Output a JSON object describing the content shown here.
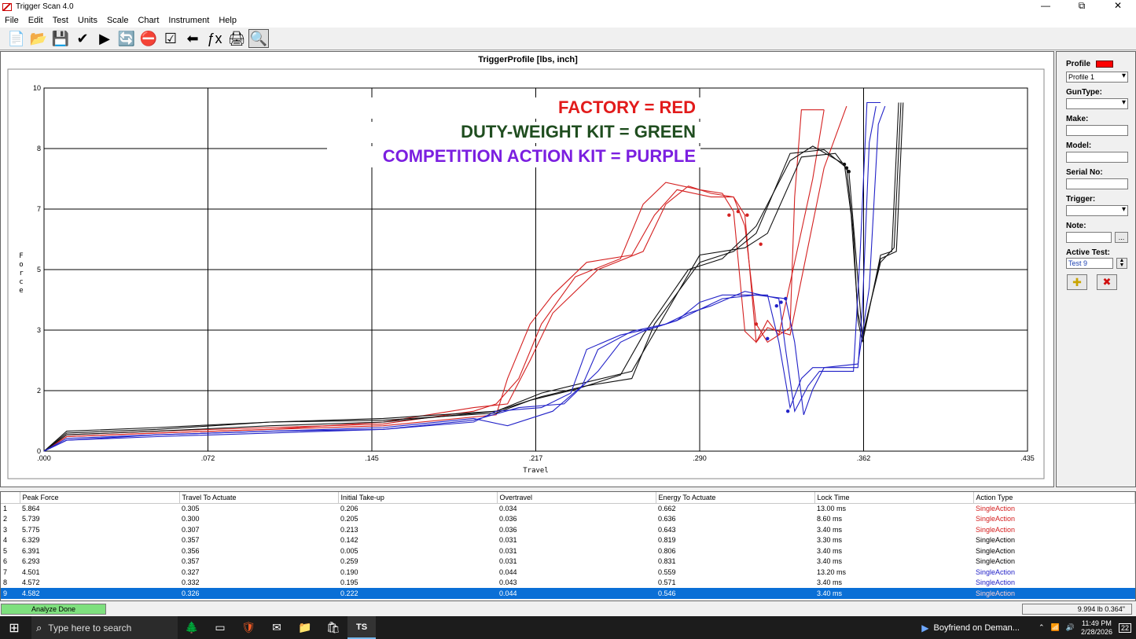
{
  "window": {
    "title": "Trigger Scan 4.0",
    "min": "—",
    "restore": "⧉",
    "close": "✕"
  },
  "menu": [
    "File",
    "Edit",
    "Test",
    "Units",
    "Scale",
    "Chart",
    "Instrument",
    "Help"
  ],
  "toolbar": [
    {
      "name": "new-icon",
      "glyph": "📄"
    },
    {
      "name": "open-folder-icon",
      "glyph": "📂"
    },
    {
      "name": "save-icon",
      "glyph": "💾"
    },
    {
      "name": "checkmark-icon",
      "glyph": "✔"
    },
    {
      "name": "play-icon",
      "glyph": "▶"
    },
    {
      "name": "refresh-icon",
      "glyph": "🔄"
    },
    {
      "name": "stop-icon",
      "glyph": "⛔"
    },
    {
      "name": "checklist-icon",
      "glyph": "☑"
    },
    {
      "name": "back-arrow-icon",
      "glyph": "⬅"
    },
    {
      "name": "function-icon",
      "glyph": "ƒx"
    },
    {
      "name": "print-icon",
      "glyph": "🖨"
    },
    {
      "name": "print-preview-icon",
      "glyph": "🔍"
    }
  ],
  "chart_data": {
    "type": "line",
    "title": "TriggerProfile [lbs, inch]",
    "xlabel": "Travel",
    "ylabel": "Force",
    "x_ticks": [
      ".000",
      ".072",
      ".145",
      ".217",
      ".290",
      ".362",
      ".435"
    ],
    "y_ticks": [
      "0",
      "2",
      "3",
      "5",
      "7",
      "8",
      "10"
    ],
    "xlim": [
      0,
      0.435
    ],
    "ylim": [
      0,
      10
    ],
    "grid": true,
    "annotations": [
      {
        "text": "FACTORY = RED",
        "color": "#e21b1b"
      },
      {
        "text": "DUTY-WEIGHT KIT = GREEN",
        "color": "#1f4d1f"
      },
      {
        "text": "COMPETITION ACTION KIT = PURPLE",
        "color": "#7b1fe0"
      }
    ],
    "series": [
      {
        "color": "#d42020",
        "x": [
          0,
          0.01,
          0.05,
          0.1,
          0.15,
          0.2,
          0.205,
          0.215,
          0.225,
          0.24,
          0.26,
          0.27,
          0.28,
          0.295,
          0.305,
          0.31,
          0.315,
          0.32,
          0.325,
          0.33,
          0.332,
          0.335,
          0.345
        ],
        "y": [
          0,
          0.4,
          0.5,
          0.6,
          0.7,
          1.0,
          2.0,
          3.5,
          4.3,
          5.2,
          5.4,
          6.5,
          7.2,
          7.0,
          7.0,
          6.2,
          3.5,
          3.0,
          3.2,
          3.4,
          7.0,
          9.4,
          9.4
        ],
        "dots": [
          [
            0.307,
            6.6
          ],
          [
            0.315,
            3.5
          ]
        ]
      },
      {
        "color": "#d42020",
        "x": [
          0,
          0.01,
          0.05,
          0.1,
          0.15,
          0.19,
          0.2,
          0.21,
          0.22,
          0.235,
          0.255,
          0.265,
          0.275,
          0.29,
          0.3,
          0.305,
          0.31,
          0.315,
          0.32,
          0.325,
          0.34,
          0.345
        ],
        "y": [
          0,
          0.45,
          0.55,
          0.65,
          0.75,
          1.1,
          1.3,
          2.0,
          3.5,
          4.8,
          5.3,
          6.8,
          7.4,
          7.2,
          7.1,
          6.6,
          3.3,
          3.0,
          3.6,
          3.2,
          7.5,
          9.4
        ],
        "dots": [
          [
            0.303,
            6.5
          ],
          [
            0.317,
            5.7
          ]
        ]
      },
      {
        "color": "#d42020",
        "x": [
          0,
          0.01,
          0.05,
          0.1,
          0.15,
          0.19,
          0.205,
          0.215,
          0.225,
          0.245,
          0.265,
          0.275,
          0.285,
          0.295,
          0.305,
          0.31,
          0.315,
          0.32,
          0.33,
          0.345,
          0.355
        ],
        "y": [
          0,
          0.4,
          0.5,
          0.6,
          0.8,
          1.2,
          1.3,
          2.5,
          3.8,
          5.0,
          5.5,
          6.8,
          7.3,
          7.1,
          7.0,
          6.5,
          3.0,
          3.4,
          3.2,
          7.8,
          9.5
        ],
        "dots": [
          [
            0.311,
            6.5
          ]
        ]
      },
      {
        "color": "#111111",
        "x": [
          0,
          0.01,
          0.05,
          0.1,
          0.15,
          0.2,
          0.22,
          0.24,
          0.26,
          0.27,
          0.29,
          0.305,
          0.315,
          0.33,
          0.345,
          0.355,
          0.358,
          0.36,
          0.362,
          0.37,
          0.375,
          0.378
        ],
        "y": [
          0,
          0.5,
          0.6,
          0.8,
          0.9,
          1.1,
          1.5,
          1.8,
          2.0,
          3.5,
          5.2,
          5.5,
          6.0,
          8.2,
          8.3,
          7.8,
          6.0,
          3.6,
          3.0,
          5.4,
          5.5,
          9.6
        ],
        "dots": [
          [
            0.355,
            7.8
          ]
        ]
      },
      {
        "color": "#111111",
        "x": [
          0,
          0.01,
          0.05,
          0.1,
          0.15,
          0.2,
          0.215,
          0.235,
          0.255,
          0.265,
          0.285,
          0.3,
          0.315,
          0.33,
          0.34,
          0.354,
          0.357,
          0.36,
          0.362,
          0.37,
          0.376,
          0.379
        ],
        "y": [
          0,
          0.55,
          0.65,
          0.8,
          0.85,
          1.05,
          1.4,
          1.7,
          2.1,
          3.2,
          5.0,
          5.3,
          6.2,
          8.0,
          8.4,
          7.9,
          6.5,
          3.8,
          3.2,
          5.2,
          5.6,
          9.6
        ],
        "dots": [
          [
            0.354,
            7.9
          ]
        ]
      },
      {
        "color": "#111111",
        "x": [
          0,
          0.01,
          0.05,
          0.1,
          0.15,
          0.2,
          0.22,
          0.24,
          0.26,
          0.275,
          0.29,
          0.31,
          0.32,
          0.335,
          0.35,
          0.356,
          0.359,
          0.362,
          0.37,
          0.377,
          0.38
        ],
        "y": [
          0,
          0.45,
          0.55,
          0.7,
          0.8,
          1.1,
          1.6,
          1.9,
          2.2,
          3.8,
          5.4,
          5.6,
          6.0,
          8.1,
          8.2,
          7.7,
          5.5,
          3.1,
          5.3,
          5.5,
          9.6
        ],
        "dots": [
          [
            0.356,
            7.7
          ]
        ]
      },
      {
        "color": "#2222c8",
        "x": [
          0,
          0.01,
          0.05,
          0.1,
          0.15,
          0.19,
          0.2,
          0.22,
          0.233,
          0.24,
          0.255,
          0.27,
          0.28,
          0.29,
          0.3,
          0.32,
          0.325,
          0.33,
          0.335,
          0.34,
          0.36,
          0.362,
          0.365,
          0.368
        ],
        "y": [
          0,
          0.3,
          0.4,
          0.5,
          0.6,
          0.8,
          1.1,
          1.2,
          1.6,
          2.8,
          3.2,
          3.4,
          3.6,
          4.1,
          4.3,
          4.3,
          3.0,
          1.2,
          2.0,
          2.3,
          2.3,
          4.0,
          8.5,
          9.5
        ],
        "dots": [
          [
            0.32,
            3.1
          ],
          [
            0.324,
            4.0
          ]
        ]
      },
      {
        "color": "#2222c8",
        "x": [
          0,
          0.01,
          0.05,
          0.1,
          0.15,
          0.19,
          0.205,
          0.225,
          0.238,
          0.245,
          0.26,
          0.275,
          0.285,
          0.295,
          0.31,
          0.325,
          0.328,
          0.332,
          0.338,
          0.343,
          0.358,
          0.361,
          0.364,
          0.37
        ],
        "y": [
          0,
          0.3,
          0.45,
          0.55,
          0.65,
          0.9,
          0.7,
          1.1,
          1.8,
          2.8,
          3.3,
          3.5,
          3.8,
          4.0,
          4.4,
          4.2,
          2.8,
          1.1,
          1.8,
          2.2,
          2.2,
          5.5,
          9.6,
          9.6
        ],
        "dots": [
          [
            0.326,
            4.1
          ],
          [
            0.329,
            1.1
          ]
        ]
      },
      {
        "color": "#2222c8",
        "x": [
          0,
          0.01,
          0.05,
          0.1,
          0.15,
          0.19,
          0.21,
          0.23,
          0.245,
          0.255,
          0.265,
          0.28,
          0.29,
          0.3,
          0.315,
          0.328,
          0.332,
          0.336,
          0.34,
          0.345,
          0.36,
          0.365,
          0.369,
          0.372
        ],
        "y": [
          0,
          0.35,
          0.45,
          0.55,
          0.6,
          0.85,
          1.2,
          1.3,
          2.2,
          3.0,
          3.3,
          3.6,
          3.9,
          4.2,
          4.3,
          4.2,
          3.0,
          1.0,
          1.7,
          2.3,
          2.4,
          4.5,
          9.0,
          9.5
        ],
        "dots": [
          [
            0.328,
            4.2
          ]
        ]
      }
    ]
  },
  "right_panel": {
    "profile_label": "Profile",
    "profile_color": "#ff0000",
    "profile_select": "Profile 1",
    "guntype_label": "GunType:",
    "make_label": "Make:",
    "model_label": "Model:",
    "serial_label": "Serial No:",
    "trigger_label": "Trigger:",
    "note_label": "Note:",
    "note_btn": "...",
    "active_test_label": "Active Test:",
    "active_test_value": "Test 9",
    "add_glyph": "✚",
    "delete_glyph": "✖"
  },
  "table": {
    "columns": [
      "",
      "Peak Force",
      "Travel To Actuate",
      "Initial Take-up",
      "Overtravel",
      "Energy To Actuate",
      "Lock Time",
      "Action Type"
    ],
    "rows": [
      {
        "cells": [
          "1",
          "5.864",
          "0.305",
          "0.206",
          "0.034",
          "0.662",
          "13.00 ms",
          "SingleAction"
        ],
        "color": "#d42020"
      },
      {
        "cells": [
          "2",
          "5.739",
          "0.300",
          "0.205",
          "0.036",
          "0.636",
          "8.60 ms",
          "SingleAction"
        ],
        "color": "#d42020"
      },
      {
        "cells": [
          "3",
          "5.775",
          "0.307",
          "0.213",
          "0.036",
          "0.643",
          "3.40 ms",
          "SingleAction"
        ],
        "color": "#d42020"
      },
      {
        "cells": [
          "4",
          "6.329",
          "0.357",
          "0.142",
          "0.031",
          "0.819",
          "3.30 ms",
          "SingleAction"
        ],
        "color": "#000000"
      },
      {
        "cells": [
          "5",
          "6.391",
          "0.356",
          "0.005",
          "0.031",
          "0.806",
          "3.40 ms",
          "SingleAction"
        ],
        "color": "#000000"
      },
      {
        "cells": [
          "6",
          "6.293",
          "0.357",
          "0.259",
          "0.031",
          "0.831",
          "3.40 ms",
          "SingleAction"
        ],
        "color": "#000000"
      },
      {
        "cells": [
          "7",
          "4.501",
          "0.327",
          "0.190",
          "0.044",
          "0.559",
          "13.20 ms",
          "SingleAction"
        ],
        "color": "#2222c8"
      },
      {
        "cells": [
          "8",
          "4.572",
          "0.332",
          "0.195",
          "0.043",
          "0.571",
          "3.40 ms",
          "SingleAction"
        ],
        "color": "#2222c8"
      },
      {
        "cells": [
          "9",
          "4.582",
          "0.326",
          "0.222",
          "0.044",
          "0.546",
          "3.40 ms",
          "SingleAction"
        ],
        "color": "#2222c8",
        "selected": true
      }
    ]
  },
  "status": {
    "left": "Analyze Done",
    "right": "9.994 lb  0.364\""
  },
  "taskbar": {
    "search_placeholder": "Type here to search",
    "media": "Boyfriend on Deman...",
    "time": "11:49 PM",
    "date": "2/28/2026",
    "notif_count": "22"
  }
}
